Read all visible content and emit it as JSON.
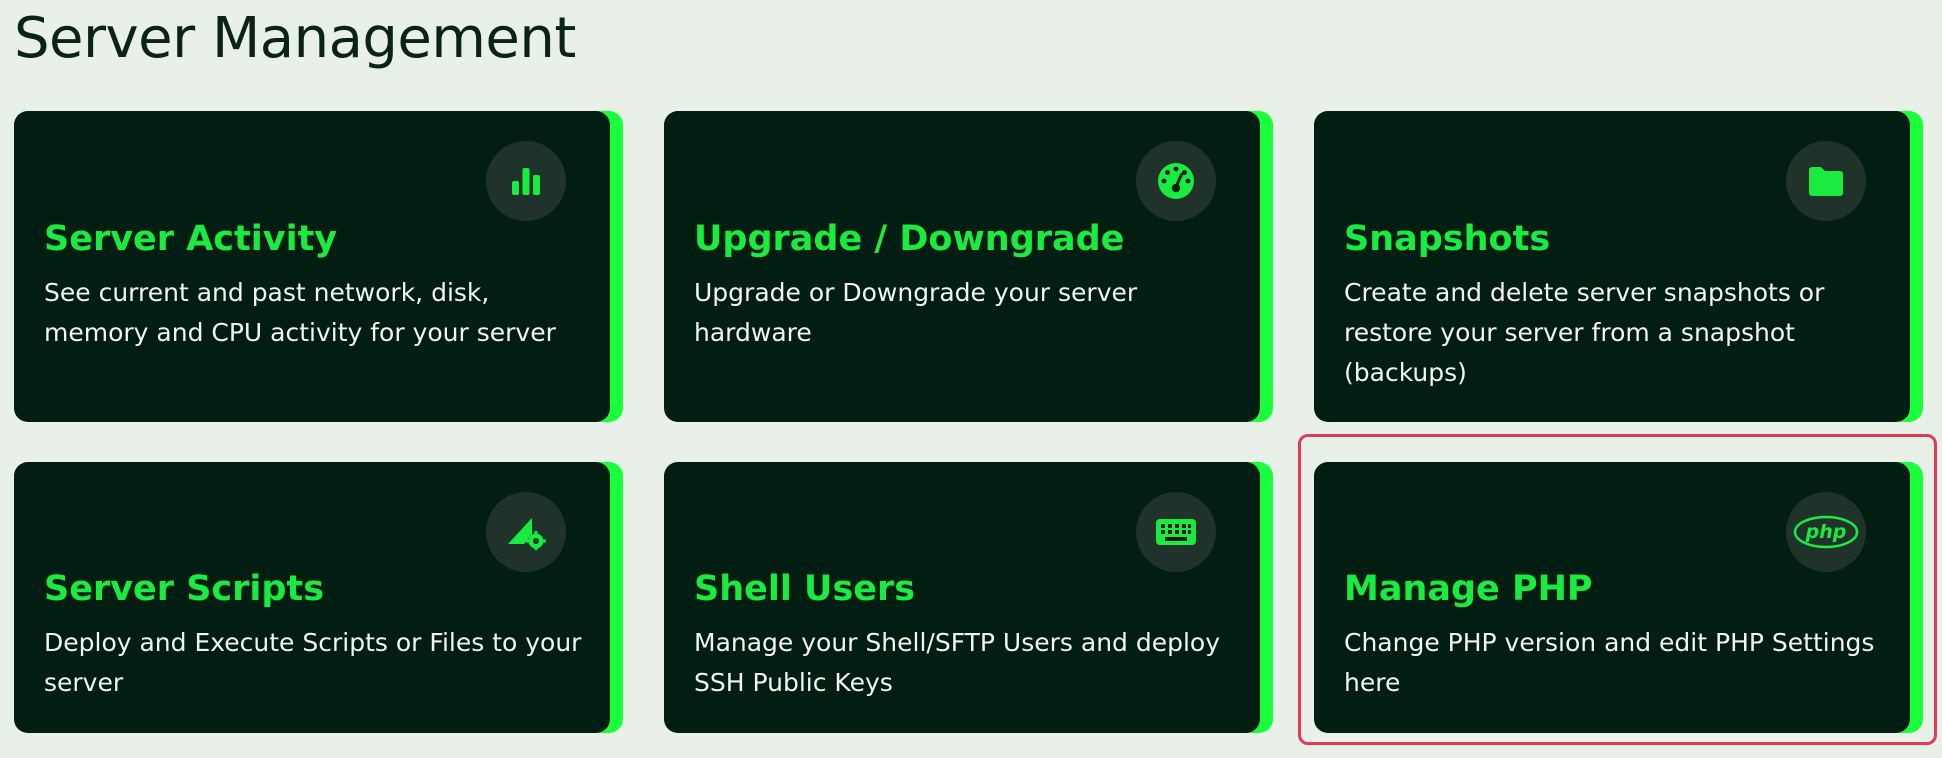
{
  "page": {
    "title": "Server Management"
  },
  "cards": [
    {
      "title": "Server Activity",
      "description": "See current and past network, disk, memory and CPU activity for your server",
      "icon": "bar-chart-icon"
    },
    {
      "title": "Upgrade / Downgrade",
      "description": "Upgrade or Downgrade your server hardware",
      "icon": "gauge-icon"
    },
    {
      "title": "Snapshots",
      "description": "Create and delete server snapshots or restore your server from a snapshot (backups)",
      "icon": "folder-icon"
    },
    {
      "title": "Server Scripts",
      "description": "Deploy and Execute Scripts or Files to your server",
      "icon": "script-gear-icon"
    },
    {
      "title": "Shell Users",
      "description": "Manage your Shell/SFTP Users and deploy SSH Public Keys",
      "icon": "keyboard-icon"
    },
    {
      "title": "Manage PHP",
      "description": "Change PHP version and edit PHP Settings here",
      "icon": "php-icon",
      "icon_text": "php"
    }
  ],
  "colors": {
    "background": "#e8f0e8",
    "card_bg": "#021d12",
    "accent": "#1aeb40",
    "icon_circle": "#20332a",
    "highlight": "#e6395a"
  }
}
